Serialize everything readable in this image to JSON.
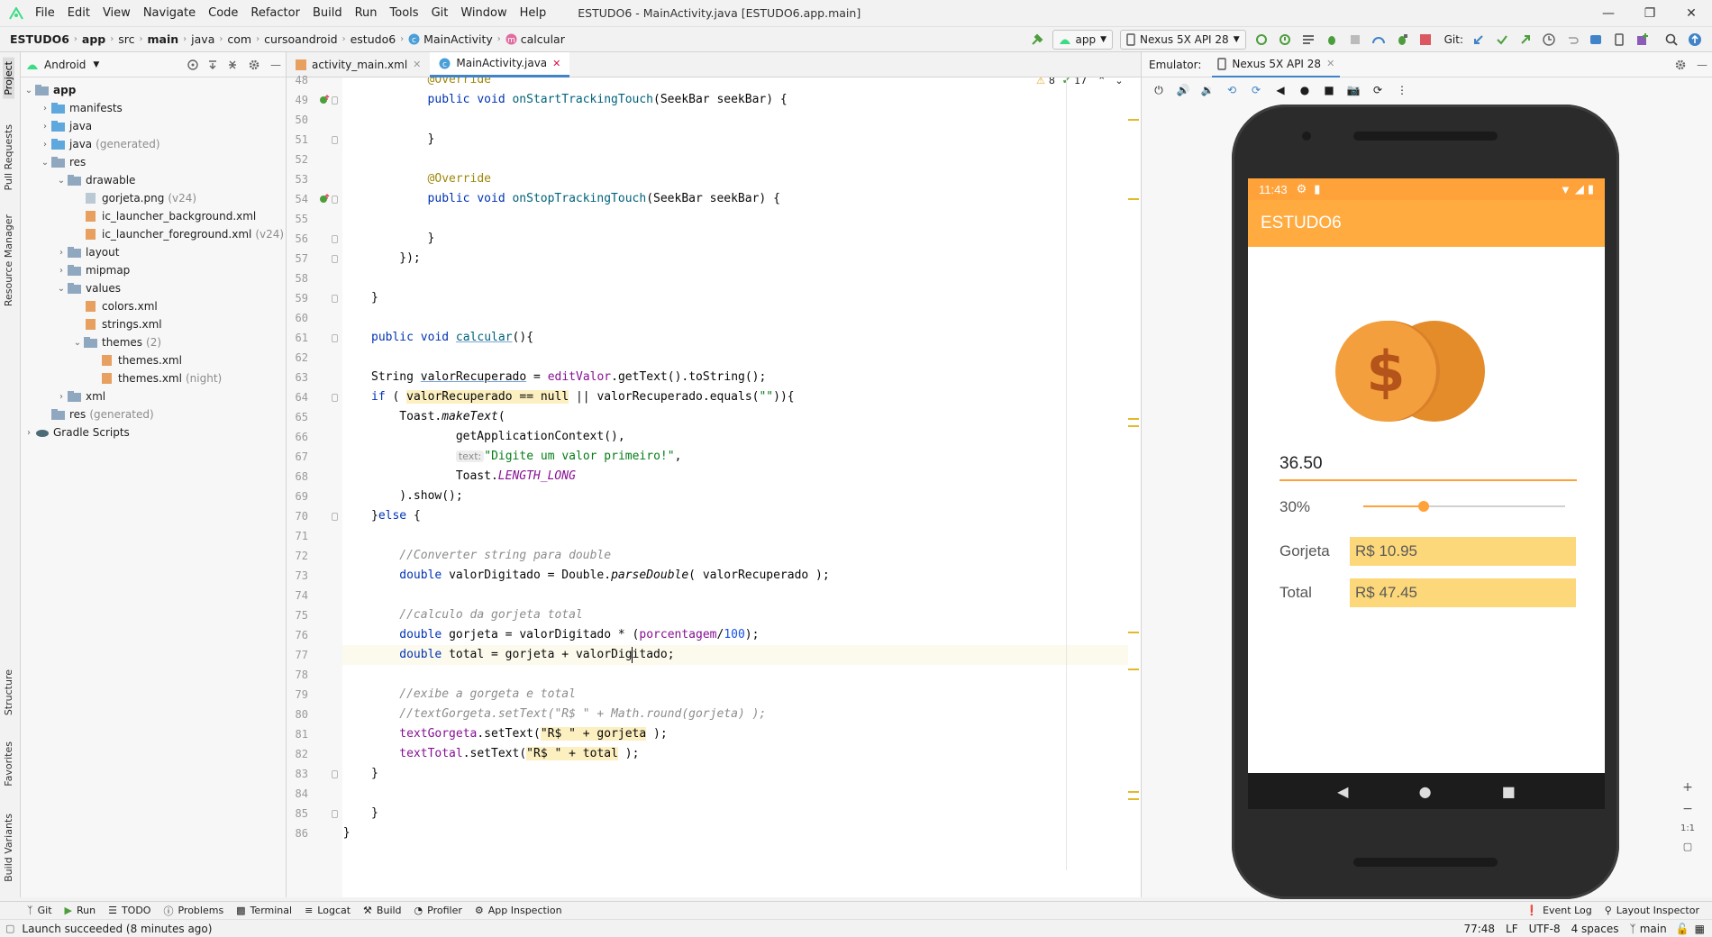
{
  "window": {
    "title": "ESTUDO6 - MainActivity.java [ESTUDO6.app.main]",
    "menu": [
      "File",
      "Edit",
      "View",
      "Navigate",
      "Code",
      "Refactor",
      "Build",
      "Run",
      "Tools",
      "Git",
      "Window",
      "Help"
    ]
  },
  "breadcrumb": [
    "ESTUDO6",
    "app",
    "src",
    "main",
    "java",
    "com",
    "cursoandroid",
    "estudo6",
    "MainActivity",
    "calcular"
  ],
  "toolbar": {
    "run_config": "app",
    "device": "Nexus 5X API 28",
    "git_label": "Git:"
  },
  "project": {
    "view_label": "Android",
    "tree": [
      {
        "label": "app",
        "hint": "",
        "bold": true
      },
      {
        "label": "manifests",
        "hint": ""
      },
      {
        "label": "java",
        "hint": ""
      },
      {
        "label": "java",
        "hint": "(generated)"
      },
      {
        "label": "res",
        "hint": ""
      },
      {
        "label": "drawable",
        "hint": ""
      },
      {
        "label": "gorjeta.png",
        "hint": "(v24)"
      },
      {
        "label": "ic_launcher_background.xml",
        "hint": ""
      },
      {
        "label": "ic_launcher_foreground.xml",
        "hint": "(v24)"
      },
      {
        "label": "layout",
        "hint": ""
      },
      {
        "label": "mipmap",
        "hint": ""
      },
      {
        "label": "values",
        "hint": ""
      },
      {
        "label": "colors.xml",
        "hint": ""
      },
      {
        "label": "strings.xml",
        "hint": ""
      },
      {
        "label": "themes",
        "hint": "(2)"
      },
      {
        "label": "themes.xml",
        "hint": ""
      },
      {
        "label": "themes.xml",
        "hint": "(night)"
      },
      {
        "label": "xml",
        "hint": ""
      },
      {
        "label": "res",
        "hint": "(generated)"
      },
      {
        "label": "Gradle Scripts",
        "hint": ""
      }
    ]
  },
  "left_strip": [
    "Project",
    "Pull Requests",
    "Resource Manager",
    "Structure",
    "Favorites",
    "Build Variants"
  ],
  "editor": {
    "tabs": [
      "activity_main.xml",
      "MainActivity.java"
    ],
    "warnings": "8",
    "checks": "17",
    "line_numbers": [
      "48",
      "49",
      "50",
      "51",
      "52",
      "53",
      "54",
      "55",
      "56",
      "57",
      "58",
      "59",
      "60",
      "61",
      "62",
      "63",
      "64",
      "65",
      "66",
      "67",
      "68",
      "69",
      "70",
      "71",
      "72",
      "73",
      "74",
      "75",
      "76",
      "77",
      "78",
      "79",
      "80",
      "81",
      "82",
      "83",
      "84",
      "85",
      "86"
    ],
    "code": {
      "l48": "@Override",
      "l49a": "public void ",
      "l49b": "onStartTrackingTouch",
      "l49c": "(SeekBar seekBar) {",
      "l51": "}",
      "l53": "@Override",
      "l54a": "public void ",
      "l54b": "onStopTrackingTouch",
      "l54c": "(SeekBar seekBar) {",
      "l56": "}",
      "l57": "});",
      "l59": "}",
      "l61a": "public void ",
      "l61b": "calcular",
      "l61c": "(){",
      "l63a": "String ",
      "l63b": "valorRecuperado",
      "l63c": " = ",
      "l63d": "editValor",
      "l63e": ".getText().toString();",
      "l64a": "if",
      "l64b": " ( ",
      "l64c": "valorRecuperado == null",
      "l64d": " || valorRecuperado.equals(",
      "l64e": "\"\"",
      "l64f": ")){",
      "l65a": "Toast.",
      "l65b": "makeText",
      "l65c": "(",
      "l66": "getApplicationContext(),",
      "l67a": "text:",
      "l67b": "\"Digite um valor primeiro!\"",
      "l67c": ",",
      "l68a": "Toast.",
      "l68b": "LENGTH_LONG",
      "l69": ").show();",
      "l70a": "}",
      "l70b": "else",
      "l70c": " {",
      "l72": "//Converter string para double",
      "l73a": "double ",
      "l73b": "valorDigitado = Double.",
      "l73c": "parseDouble",
      "l73d": "( valorRecuperado );",
      "l75": "//calculo da gorjeta total",
      "l76a": "double ",
      "l76b": "gorjeta = valorDigitado * (",
      "l76c": "porcentagem",
      "l76d": "/",
      "l76e": "100",
      "l76f": ");",
      "l77a": "double ",
      "l77b": "total = gorjeta + valorDigitado;",
      "l79": "//exibe a gorgeta e total",
      "l80": "//textGorgeta.setText(\"R$ \" + Math.round(gorjeta) );",
      "l81a": "textGorgeta",
      "l81b": ".setText(",
      "l81c": "\"R$ \" + gorjeta",
      "l81d": " );",
      "l82a": "textTotal",
      "l82b": ".setText(",
      "l82c": "\"R$ \" + total",
      "l82d": " );",
      "l83": "}",
      "l85": "}",
      "l86": "}"
    }
  },
  "emulator": {
    "label": "Emulator:",
    "tab": "Nexus 5X API 28",
    "zoom_ratio": "1:1",
    "app": {
      "time": "11:43",
      "title": "ESTUDO6",
      "value": "36.50",
      "percent_label": "30%",
      "seekbar_fraction": 0.3,
      "tip_label": "Gorjeta",
      "tip_value": "R$ 10.95",
      "total_label": "Total",
      "total_value": "R$ 47.45"
    }
  },
  "bottom_tools": [
    "Git",
    "Run",
    "TODO",
    "Problems",
    "Terminal",
    "Logcat",
    "Build",
    "Profiler",
    "App Inspection"
  ],
  "bottom_right_tools": [
    "Event Log",
    "Layout Inspector"
  ],
  "status": {
    "message": "Launch succeeded (8 minutes ago)",
    "position": "77:48",
    "line_sep": "LF",
    "encoding": "UTF-8",
    "indent": "4 spaces",
    "branch": "main"
  },
  "colors": {
    "accent": "#ffab40",
    "tip_box": "#fdd87a",
    "keyword": "#0033b3",
    "string": "#067d17"
  }
}
